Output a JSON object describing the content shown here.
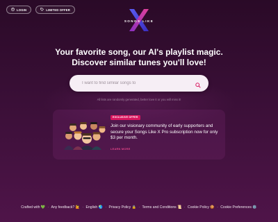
{
  "colors": {
    "background_top": "#2a0a27",
    "background_bottom": "#4f1449",
    "accent_pink": "#d8175f",
    "link_pink": "#e8458b",
    "search_bg": "#f6eef5"
  },
  "top_nav": {
    "login_label": "LOGIN",
    "login_icon": "user-circle-icon",
    "offer_label": "LIMITED OFFER",
    "offer_icon": "tag-icon"
  },
  "logo": {
    "text": "SONGS LIKE",
    "mark": "X"
  },
  "hero": {
    "line1": "Your favorite song, our AI's playlist magic.",
    "line2": "Discover similar tunes you'll love!"
  },
  "search": {
    "placeholder": "I want to find similar songs to",
    "icon": "search-icon"
  },
  "disclaimer": "All lists are randomly generated, better love it or you will miss it!",
  "promo": {
    "badge": "EXCLUSIVE OFFER",
    "text": "Join our visionary community of early supporters and secure your Songs Like X Pro subscription now for only $3 per month.",
    "link": "LEARN MORE"
  },
  "footer": {
    "crafted": "Crafted with 💚",
    "feedback": "Any feedback? 🙋",
    "language": "English 🌏",
    "privacy": "Privacy Policy 🔒",
    "terms": "Terms and Conditions 📜",
    "cookie": "Cookie Policy 🍪",
    "cookie_prefs": "Cookie Preferences ⚙️",
    "separator": "·"
  }
}
